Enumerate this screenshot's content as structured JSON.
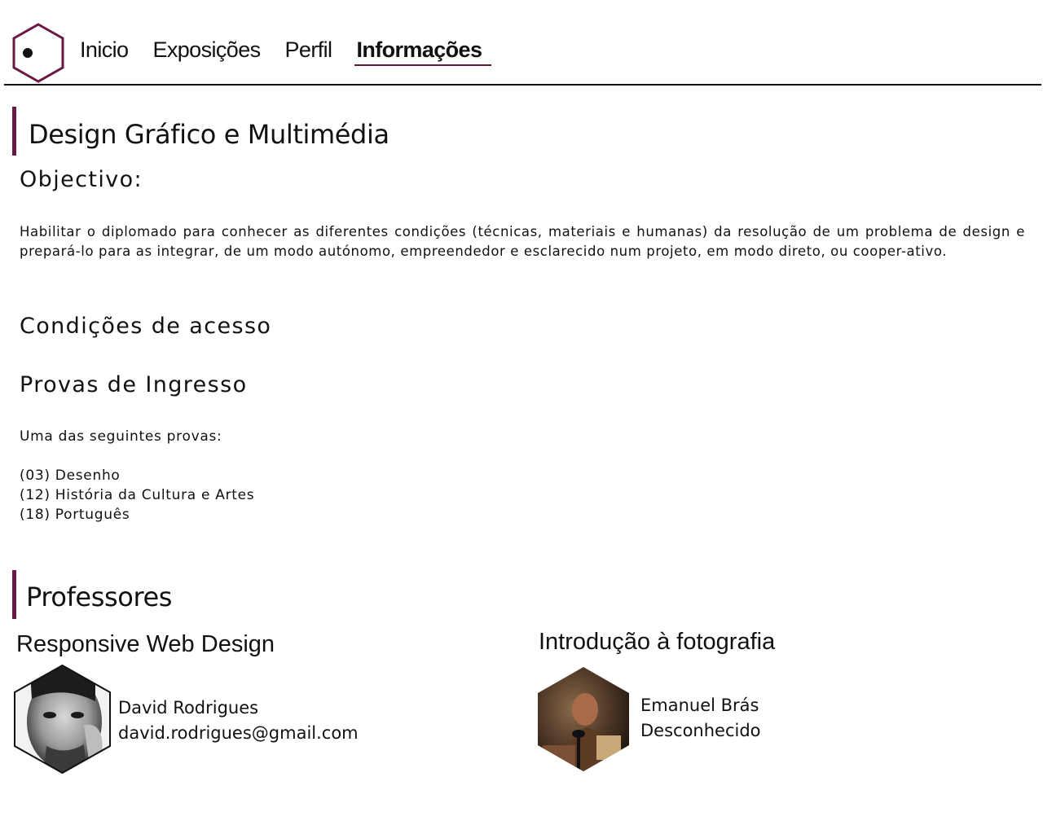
{
  "nav": {
    "items": [
      {
        "label": "Inicio",
        "active": false
      },
      {
        "label": "Exposições",
        "active": false
      },
      {
        "label": "Perfil",
        "active": false
      },
      {
        "label": "Informações",
        "active": true
      }
    ]
  },
  "colors": {
    "accent": "#6b1845",
    "text": "#111111",
    "background": "#ffffff"
  },
  "course": {
    "title": "Design Gráfico e Multimédia",
    "objective_heading": "Objectivo:",
    "objective_text": "Habilitar o diplomado para conhecer as diferentes condições (técnicas, materiais e humanas) da resolução de um problema de design e prepará-lo para as integrar, de um modo autónomo, empreendedor e esclarecido num projeto, em modo direto, ou cooper-ativo.",
    "access_heading": "Condições de acesso",
    "exams_heading": "Provas de Ingresso",
    "exams_intro": "Uma das seguintes provas:",
    "exams": [
      "(03) Desenho",
      "(12) História da Cultura e Artes",
      "(18) Português"
    ]
  },
  "professors": {
    "title": "Professores",
    "items": [
      {
        "course": "Responsive Web Design",
        "name": "David Rodrigues",
        "contact": "david.rodrigues@gmail.com"
      },
      {
        "course": "Introdução à fotografia",
        "name": "Emanuel Brás",
        "contact": "Desconhecido"
      }
    ]
  }
}
